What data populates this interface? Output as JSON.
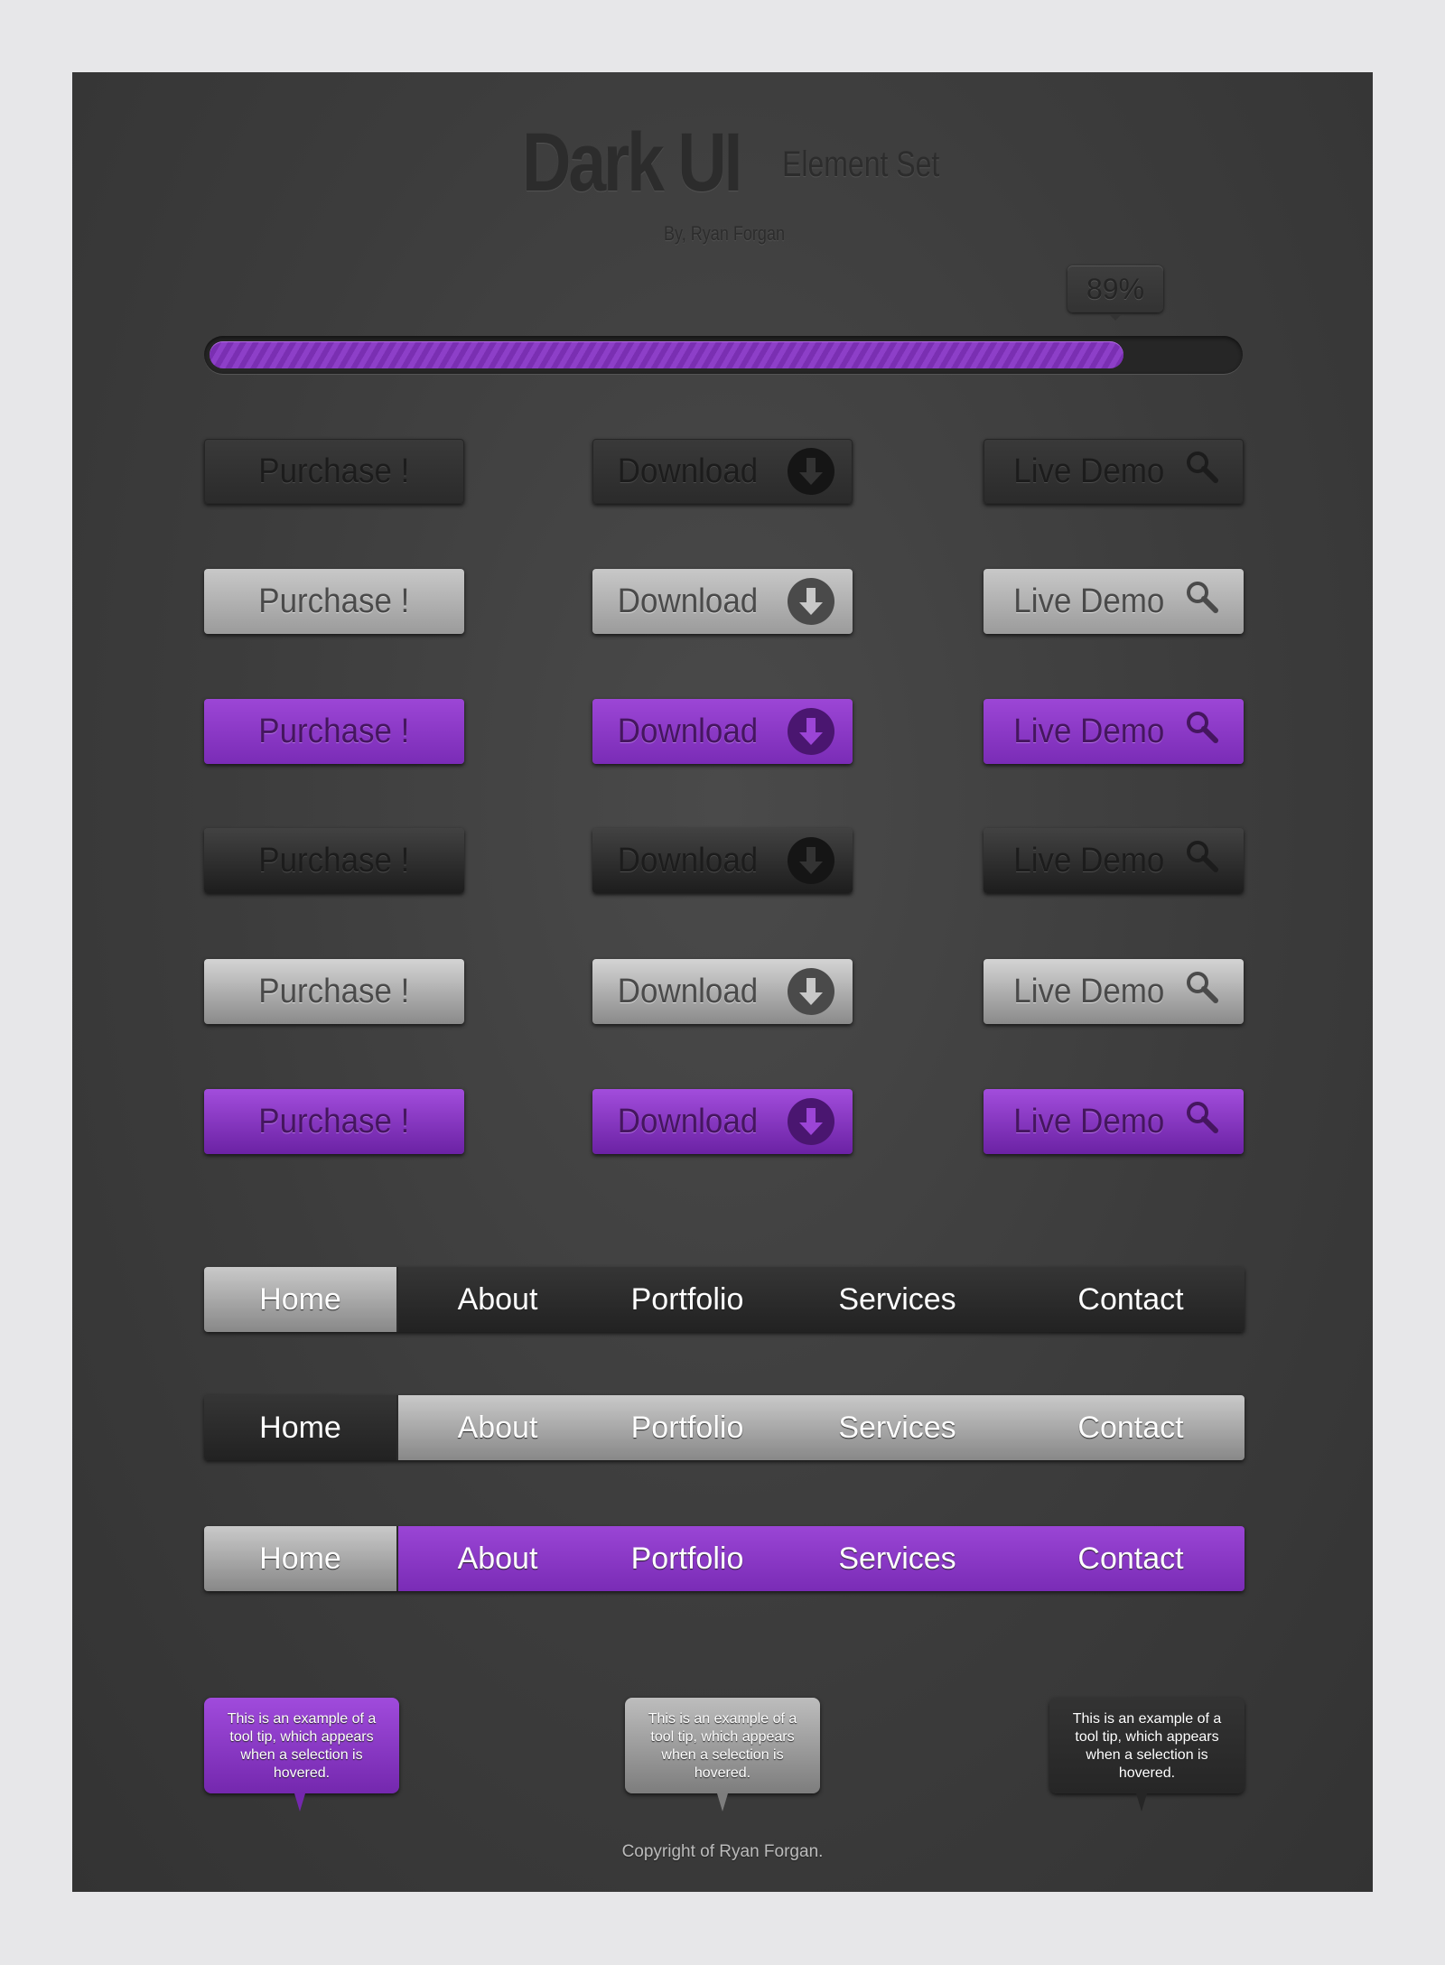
{
  "header": {
    "title": "Dark UI",
    "subtitle": "Element Set",
    "byline": "By, Ryan Forgan"
  },
  "progress": {
    "value_label": "89%",
    "value": 0.89,
    "fill_color": "#8d3fc8"
  },
  "buttons": {
    "labels": [
      "Purchase !",
      "Download",
      "Live Demo"
    ],
    "icons": [
      null,
      "download-arrow-icon",
      "search-icon"
    ],
    "rows": [
      "dark",
      "gray",
      "purple",
      "dark-gradient",
      "gray-gradient",
      "purple-gradient"
    ]
  },
  "navbars": [
    {
      "style": "dark",
      "active": "Home",
      "items": [
        "Home",
        "About",
        "Portfolio",
        "Services",
        "Contact"
      ]
    },
    {
      "style": "gray",
      "active": "Home",
      "items": [
        "Home",
        "About",
        "Portfolio",
        "Services",
        "Contact"
      ]
    },
    {
      "style": "purple",
      "active": "Home",
      "items": [
        "Home",
        "About",
        "Portfolio",
        "Services",
        "Contact"
      ]
    }
  ],
  "tooltips": [
    {
      "style": "purple",
      "text": "This is an example of a tool tip, which appears when a selection is hovered."
    },
    {
      "style": "gray",
      "text": "This is an example of a tool tip, which appears when a selection is hovered."
    },
    {
      "style": "dark",
      "text": "This is an example of a tool tip, which appears when a selection is hovered."
    }
  ],
  "footer": {
    "copyright": "Copyright of Ryan Forgan."
  },
  "colors": {
    "accent": "#8b3fcf",
    "panel": "#3c3c3c",
    "page": "#e7e7e9"
  }
}
